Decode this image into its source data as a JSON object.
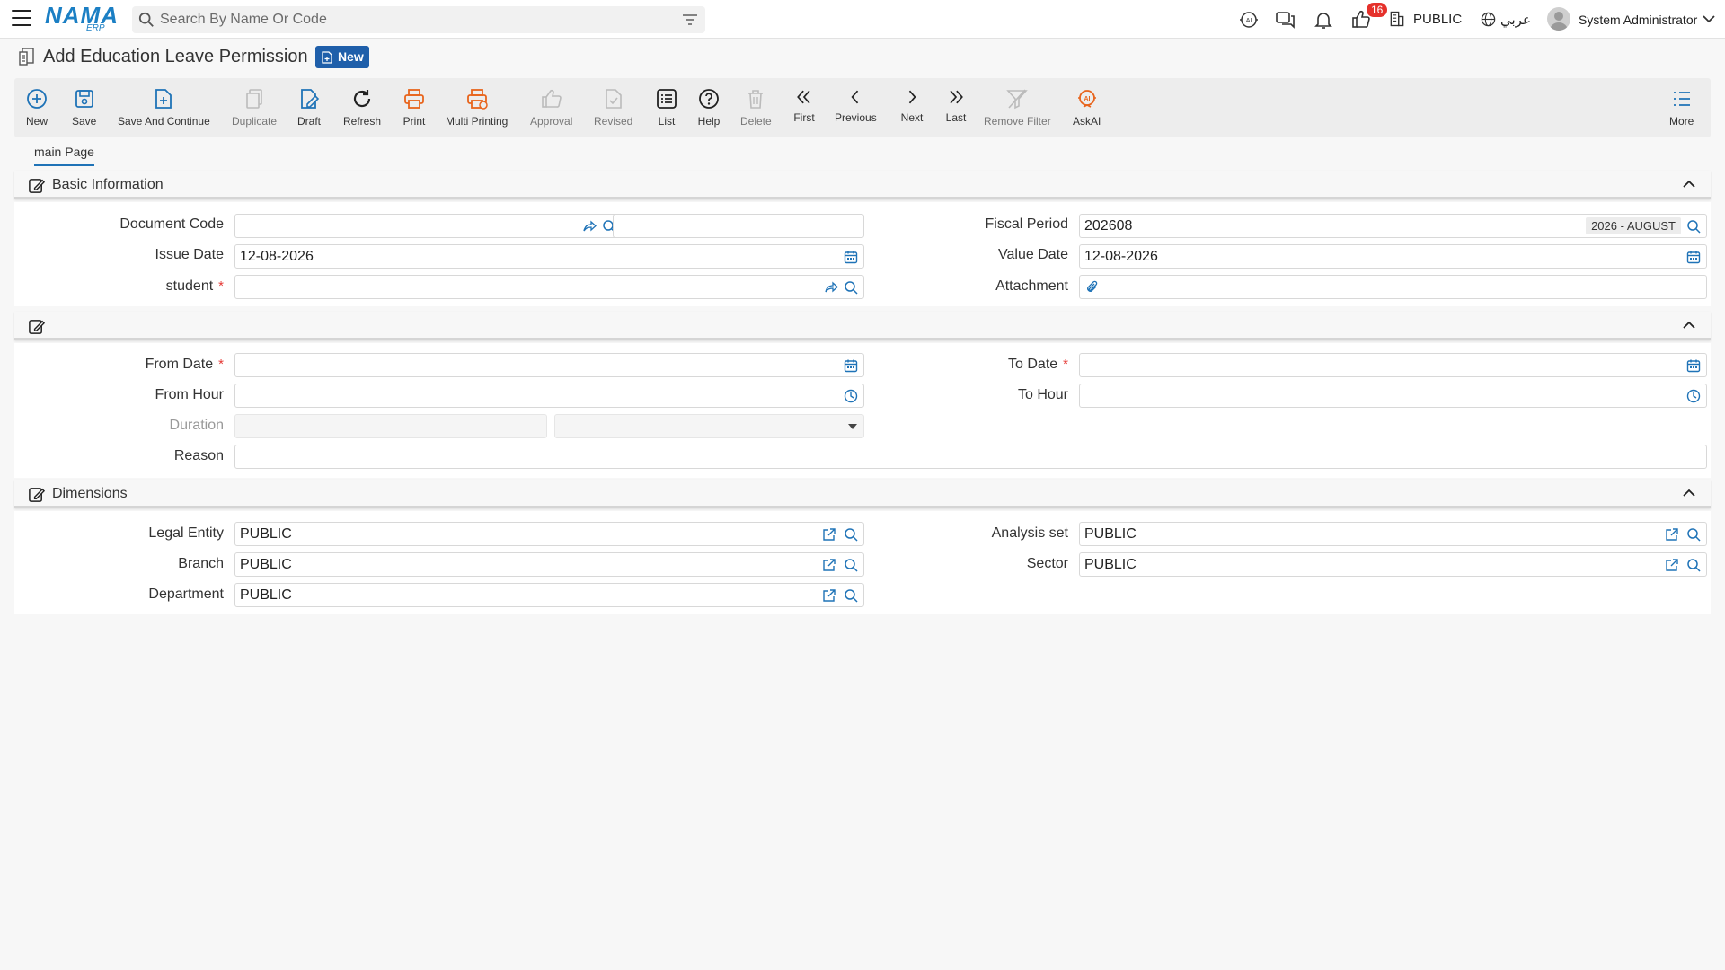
{
  "app": {
    "brand": "NAMA",
    "brand_sub": "ERP",
    "search_placeholder": "Search By Name Or Code"
  },
  "topbar": {
    "notifications_count": "16",
    "entity": "PUBLIC",
    "language": "عربي",
    "user": "System Administrator"
  },
  "page": {
    "title": "Add Education Leave Permission",
    "status_badge": "New"
  },
  "toolbar": {
    "new": "New",
    "save": "Save",
    "save_continue": "Save And Continue",
    "duplicate": "Duplicate",
    "draft": "Draft",
    "refresh": "Refresh",
    "print": "Print",
    "multi_printing": "Multi Printing",
    "approval": "Approval",
    "revised": "Revised",
    "list": "List",
    "help": "Help",
    "delete": "Delete",
    "first": "First",
    "previous": "Previous",
    "next": "Next",
    "last": "Last",
    "remove_filter": "Remove Filter",
    "askai": "AskAI",
    "more": "More"
  },
  "tabs": {
    "main": "main Page"
  },
  "basic": {
    "title": "Basic Information",
    "document_code_label": "Document Code",
    "document_code": "",
    "fiscal_period_label": "Fiscal Period",
    "fiscal_period": "202608",
    "fiscal_period_name": "2026 - AUGUST",
    "issue_date_label": "Issue Date",
    "issue_date": "12-08-2026",
    "value_date_label": "Value Date",
    "value_date": "12-08-2026",
    "student_label": "student",
    "student": "",
    "attachment_label": "Attachment"
  },
  "period": {
    "title": "",
    "from_date_label": "From Date",
    "to_date_label": "To Date",
    "from_hour_label": "From Hour",
    "to_hour_label": "To Hour",
    "duration_label": "Duration",
    "reason_label": "Reason"
  },
  "dimensions": {
    "title": "Dimensions",
    "legal_entity_label": "Legal Entity",
    "legal_entity": "PUBLIC",
    "analysis_set_label": "Analysis set",
    "analysis_set": "PUBLIC",
    "branch_label": "Branch",
    "branch": "PUBLIC",
    "sector_label": "Sector",
    "sector": "PUBLIC",
    "department_label": "Department",
    "department": "PUBLIC"
  },
  "required_mark": "*",
  "colors": {
    "accent": "#1f73b7",
    "badge_blue": "#1f5faa",
    "print_orange": "#e8641c",
    "required_red": "#e53935"
  }
}
